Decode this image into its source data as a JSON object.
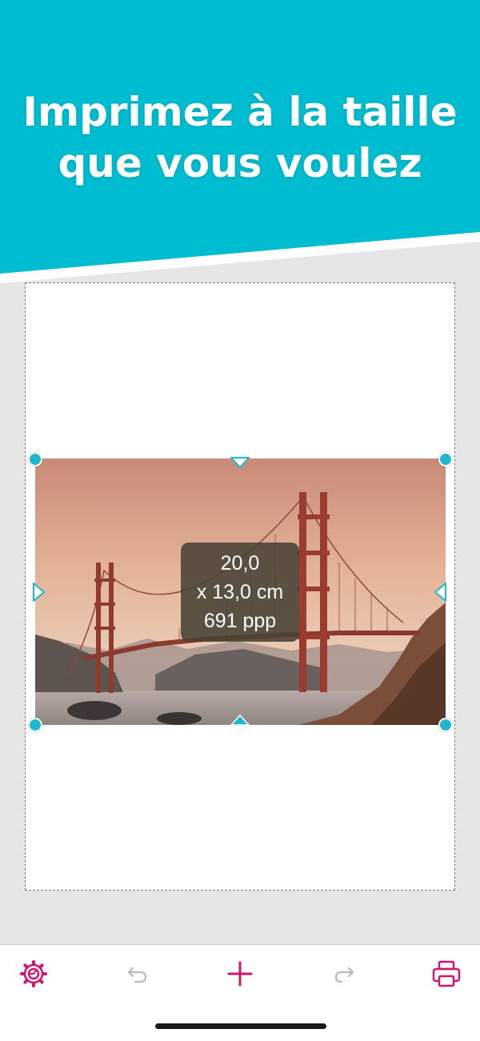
{
  "headline": {
    "line1": "Imprimez à la taille",
    "line2": "que vous voulez"
  },
  "colors": {
    "banner": "#00bcd0",
    "accent": "#d0166c",
    "handle": "#1fb8cc",
    "disabled": "#b9b9b9"
  },
  "photo": {
    "subject": "Golden Gate Bridge at sunset"
  },
  "size_badge": {
    "width": "20,0",
    "height": "x 13,0 cm",
    "resolution": "691 ppp"
  },
  "toolbar": {
    "settings_icon": "gear-icon",
    "undo_icon": "undo-icon",
    "add_icon": "plus-icon",
    "redo_icon": "redo-icon",
    "print_icon": "printer-icon"
  }
}
